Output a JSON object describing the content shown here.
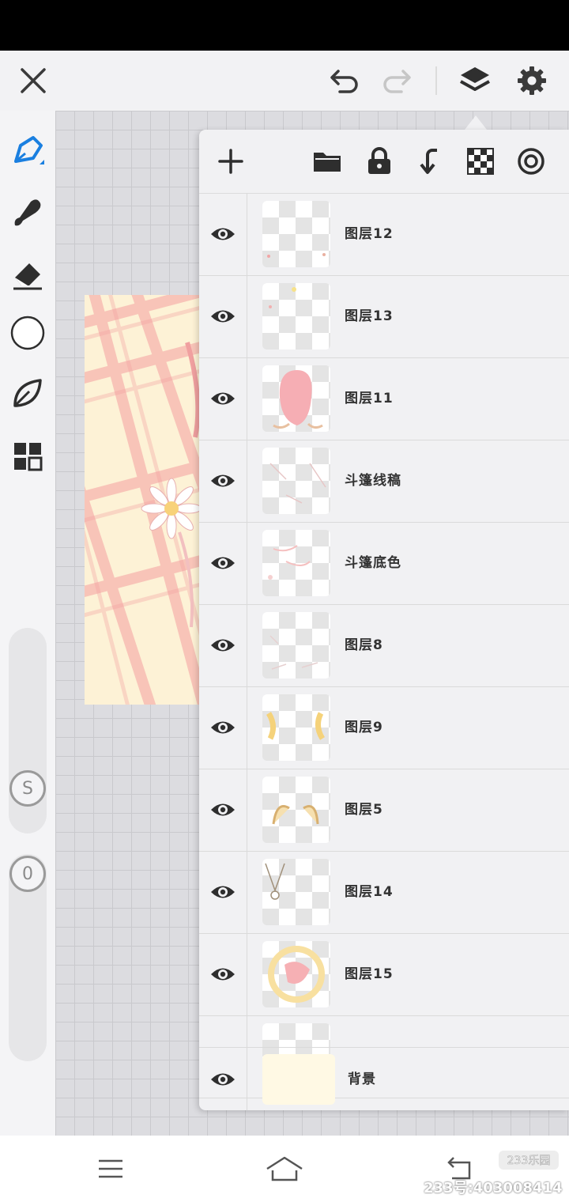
{
  "toolbar": {
    "close_icon": "close-icon",
    "undo_icon": "undo-icon",
    "redo_icon": "redo-icon",
    "layers_icon": "layers-icon",
    "settings_icon": "gear-icon"
  },
  "tools": [
    "pen-icon",
    "smudge-brush-icon",
    "eraser-icon",
    "color-circle",
    "leaf-icon",
    "grid-menu-icon"
  ],
  "sliders": {
    "size_label": "S",
    "opacity_label": "0"
  },
  "layers_panel": {
    "toolbar_icons": [
      "add-layer-icon",
      "folder-icon",
      "lock-icon",
      "merge-down-icon",
      "transparency-icon",
      "blend-icon"
    ],
    "layers": [
      {
        "name": "图层12",
        "visible": true
      },
      {
        "name": "图层13",
        "visible": true
      },
      {
        "name": "图层11",
        "visible": true
      },
      {
        "name": "斗篷线稿",
        "visible": true
      },
      {
        "name": "斗篷底色",
        "visible": true
      },
      {
        "name": "图层8",
        "visible": true
      },
      {
        "name": "图层9",
        "visible": true
      },
      {
        "name": "图层5",
        "visible": true
      },
      {
        "name": "图层14",
        "visible": true
      },
      {
        "name": "图层15",
        "visible": true
      }
    ],
    "background_layer": {
      "name": "背景",
      "visible": true
    }
  },
  "colors": {
    "accent": "#1a7fe0",
    "icon": "#333333",
    "panel_bg": "#f1f1f3"
  },
  "watermark": "233号:403008414",
  "logo_text": "233乐园"
}
